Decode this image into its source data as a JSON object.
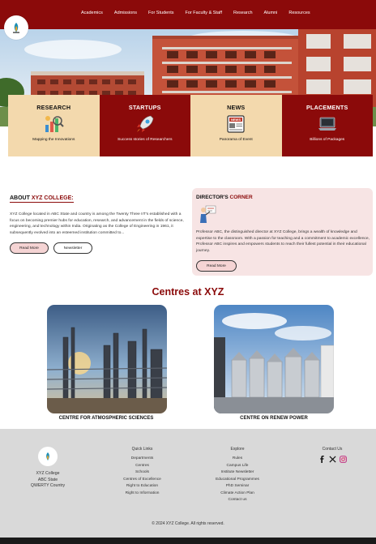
{
  "nav": {
    "items": [
      "Academics",
      "Admissions",
      "For Students",
      "For Faculty & Staff",
      "Research",
      "Alumni",
      "Resources"
    ]
  },
  "features": [
    {
      "title": "RESEARCH",
      "subtitle": "Mapping the Innovations",
      "icon": "research-icon"
    },
    {
      "title": "STARTUPS",
      "subtitle": "Success stories of Researchers",
      "icon": "rocket-icon"
    },
    {
      "title": "NEWS",
      "subtitle": "Panorama of Event",
      "icon": "newspaper-icon"
    },
    {
      "title": "PLACEMENTS",
      "subtitle": "Billions of Packages",
      "icon": "laptop-icon"
    }
  ],
  "about": {
    "heading_prefix": "ABOUT ",
    "heading_accent": "XYZ COLLEGE:",
    "body": "XYZ College located in ABC State and country is among the Twenty Three IIT's established with a focus on becoming premier hubs for education, research, and advancement in the fields of science, engineering, and technology within India. Originating as the College of Engineering in 1961, it subsequently evolved into an esteemed institution committed to...",
    "read_more": "Read More",
    "newsletter": "Newsletter"
  },
  "director": {
    "heading_prefix": "DIRECTOR'S ",
    "heading_accent": "CORNER",
    "body": "Professor ABC, the distinguished director at XYZ College, brings a wealth of knowledge and expertise to the classroom. With a passion for teaching and a commitment to academic excellence, Professor ABC inspires and empowers students to reach their fullest potential in their educational journey.",
    "read_more": "Read More"
  },
  "centres": {
    "title": "Centres at XYZ",
    "items": [
      {
        "label": "CENTRE FOR ATMOSPHERIC SCIENCES"
      },
      {
        "label": "CENTRE ON RENEW POWER"
      }
    ]
  },
  "footer": {
    "brand_lines": [
      "XYZ College",
      "ABC State",
      "QWERTY Country"
    ],
    "quick_links": {
      "title": "Quick Links",
      "items": [
        "Departments",
        "Centres",
        "Schools",
        "Centres of Excellence",
        "Right to Education",
        "Right to Information"
      ]
    },
    "explore": {
      "title": "Explore",
      "items": [
        "Rules",
        "Campus Life",
        "Institute Newsletter",
        "Educational Programmes",
        "PhD Seminar",
        "Climate Action Plan",
        "Contact us"
      ]
    },
    "contact": {
      "title": "Contact Us",
      "social": [
        "facebook-icon",
        "x-icon",
        "instagram-icon"
      ]
    },
    "copyright": "© 2024 XYZ College. All rights reserved."
  },
  "colors": {
    "brand": "#8b0a0a",
    "card_light": "#f3d9ad",
    "director_bg": "#f7e4e4",
    "footer_bg": "#d9d9d9"
  }
}
